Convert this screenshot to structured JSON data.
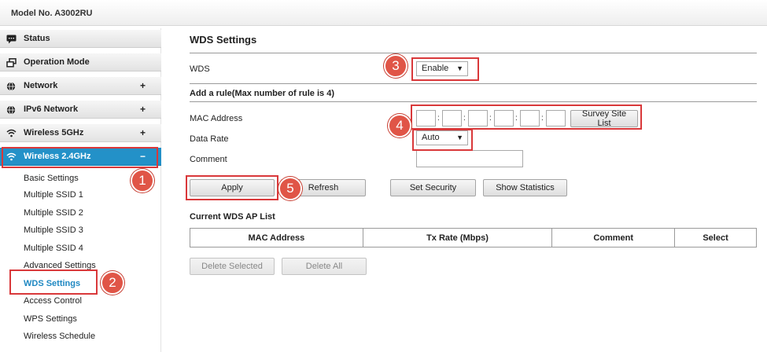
{
  "header": {
    "model": "Model No. A3002RU"
  },
  "sidebar": {
    "menu": [
      {
        "label": "Status",
        "icon": "status-icon",
        "toggle": ""
      },
      {
        "label": "Operation Mode",
        "icon": "operation-mode-icon",
        "toggle": ""
      },
      {
        "label": "Network",
        "icon": "globe-icon",
        "toggle": "+"
      },
      {
        "label": "IPv6 Network",
        "icon": "globe-icon",
        "toggle": "+"
      },
      {
        "label": "Wireless 5GHz",
        "icon": "wifi-icon",
        "toggle": "+"
      },
      {
        "label": "Wireless 2.4GHz",
        "icon": "wifi-icon",
        "toggle": "−"
      }
    ],
    "submenu": [
      "Basic Settings",
      "Multiple SSID 1",
      "Multiple SSID 2",
      "Multiple SSID 3",
      "Multiple SSID 4",
      "Advanced Settings",
      "WDS Settings",
      "Access Control",
      "WPS Settings",
      "Wireless Schedule"
    ],
    "active_submenu": "WDS Settings"
  },
  "main": {
    "title": "WDS Settings",
    "wds_label": "WDS",
    "wds_value": "Enable",
    "rule_heading": "Add a rule(Max number of rule is 4)",
    "mac_label": "MAC Address",
    "mac_values": [
      "",
      "",
      "",
      "",
      "",
      ""
    ],
    "survey_button": "Survey Site List",
    "data_rate_label": "Data Rate",
    "data_rate_value": "Auto",
    "comment_label": "Comment",
    "comment_value": "",
    "buttons": {
      "apply": "Apply",
      "refresh": "Refresh",
      "set_security": "Set Security",
      "show_statistics": "Show Statistics"
    },
    "list_heading": "Current WDS AP List",
    "list_columns": [
      "MAC Address",
      "Tx Rate (Mbps)",
      "Comment",
      "Select"
    ],
    "delete_selected": "Delete Selected",
    "delete_all": "Delete All"
  },
  "annotations": [
    "1",
    "2",
    "3",
    "4",
    "5"
  ],
  "colors": {
    "accent": "#2391c8",
    "highlight": "#d9383a",
    "badge": "#e05547"
  }
}
